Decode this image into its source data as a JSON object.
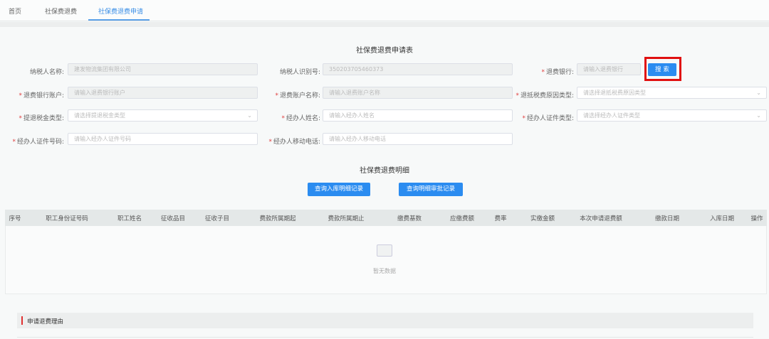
{
  "nav": {
    "tabs": [
      "首页",
      "社保费退费",
      "社保费退费申请"
    ],
    "active": 2
  },
  "form": {
    "title": "社保费退费申请表",
    "taxpayer_name": {
      "label": "纳税人名称:",
      "value": "建发物流集团有限公司"
    },
    "taxpayer_id": {
      "label": "纳税人识别号:",
      "value": "350203705460373"
    },
    "refund_bank": {
      "label": "退费银行:",
      "placeholder": "请输入退费银行"
    },
    "search_button": "搜 索",
    "bank_account": {
      "label": "退费银行账户:",
      "placeholder": "请输入退费银行账户"
    },
    "account_name": {
      "label": "退费账户名称:",
      "placeholder": "请输入退费账户名称"
    },
    "reason_type": {
      "label": "退抵税费原因类型:",
      "placeholder": "请选择退抵税费原因类型"
    },
    "tax_type": {
      "label": "提退税金类型:",
      "placeholder": "请选择提退税金类型"
    },
    "agent_name": {
      "label": "经办人姓名:",
      "placeholder": "请输入经办人姓名"
    },
    "agent_id_type": {
      "label": "经办人证件类型:",
      "placeholder": "请选择经办人证件类型"
    },
    "agent_id_no": {
      "label": "经办人证件号码:",
      "placeholder": "请输入经办人证件号码"
    },
    "agent_phone": {
      "label": "经办人移动电话:",
      "placeholder": "请输入经办人移动电话"
    },
    "required_mark": "*"
  },
  "detail": {
    "title": "社保费退费明细",
    "buttons": [
      "查询入库明细记录",
      "查询明细审批记录"
    ],
    "columns": [
      "序号",
      "职工身份证号码",
      "职工姓名",
      "征收品目",
      "征收子目",
      "费款所属期起",
      "费款所属期止",
      "缴费基数",
      "应缴费额",
      "费率",
      "实缴金额",
      "本次申请退费额",
      "缴款日期",
      "入库日期",
      "操作"
    ],
    "empty_text": "暂无数据"
  },
  "reason": {
    "title": "申请退费理由"
  },
  "colors": {
    "primary": "#2b8cf0",
    "highlight": "#e01010",
    "required": "#e04040"
  }
}
